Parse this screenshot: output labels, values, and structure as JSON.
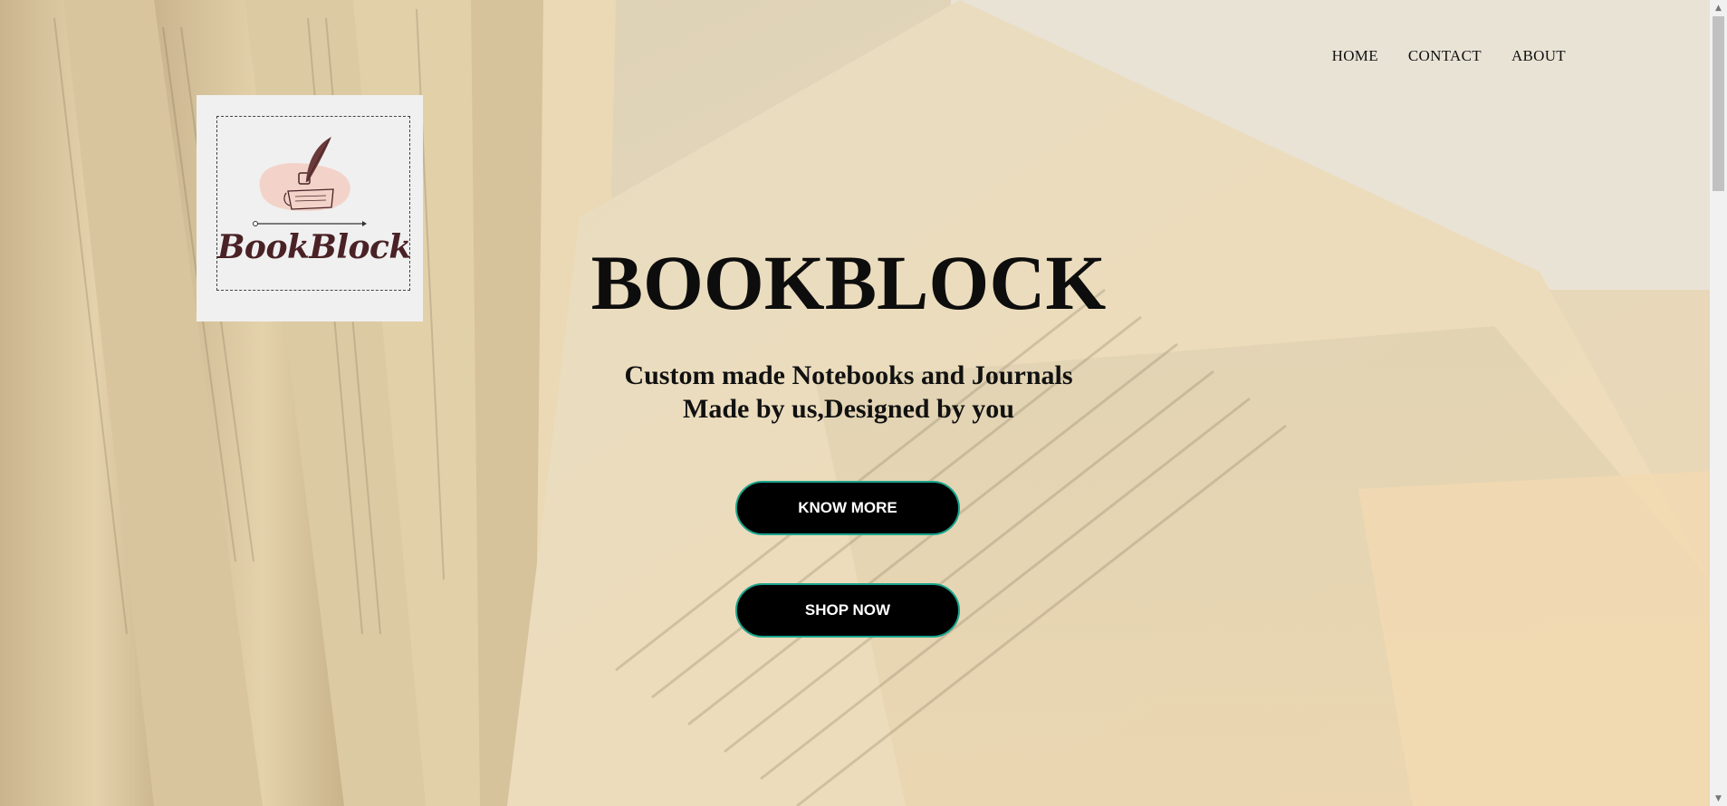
{
  "nav": {
    "items": [
      {
        "label": "HOME"
      },
      {
        "label": "CONTACT"
      },
      {
        "label": "ABOUT"
      }
    ]
  },
  "logo": {
    "text": "BookBlock",
    "icon": "quill-and-ink-icon"
  },
  "hero": {
    "title": "BOOKBLOCK",
    "subtitle_line1": "Custom made Notebooks and Journals",
    "subtitle_line2": "Made by us,Designed by you"
  },
  "buttons": {
    "know_more": "KNOW MORE",
    "shop_now": "SHOP NOW"
  },
  "colors": {
    "button_bg": "#000000",
    "button_border": "#1aa38c",
    "logo_text": "#4a2226",
    "background": "#e9dcc2"
  },
  "scrollbar": {
    "up_icon": "▲",
    "down_icon": "▼"
  }
}
